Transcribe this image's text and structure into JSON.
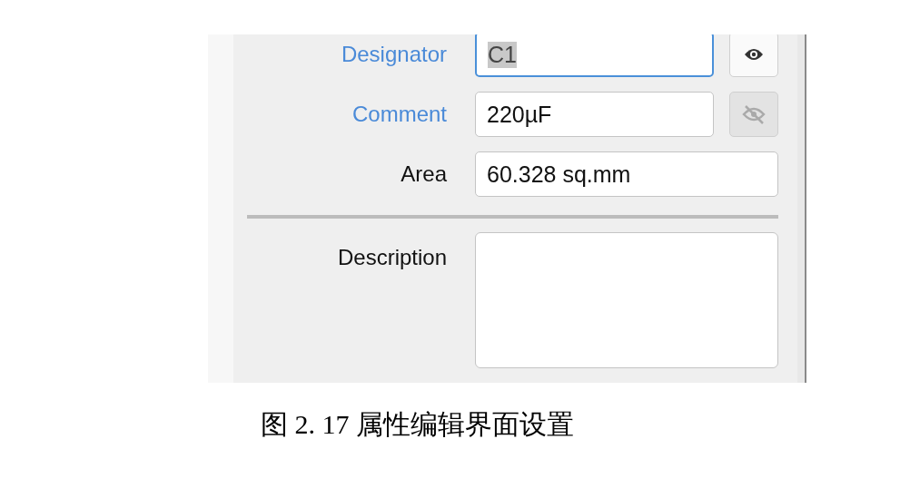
{
  "properties": [
    {
      "label": "Designator",
      "value": "C1",
      "kind": "toggle",
      "highlighted": true,
      "focused": true,
      "selected": true,
      "visible": true
    },
    {
      "label": "Comment",
      "value": "220µF",
      "kind": "toggle",
      "highlighted": true,
      "focused": false,
      "selected": false,
      "visible": false
    },
    {
      "label": "Area",
      "value": "60.328 sq.mm",
      "kind": "plain",
      "highlighted": false,
      "focused": false,
      "selected": false
    }
  ],
  "description": {
    "label": "Description"
  },
  "caption": "图 2. 17 属性编辑界面设置"
}
